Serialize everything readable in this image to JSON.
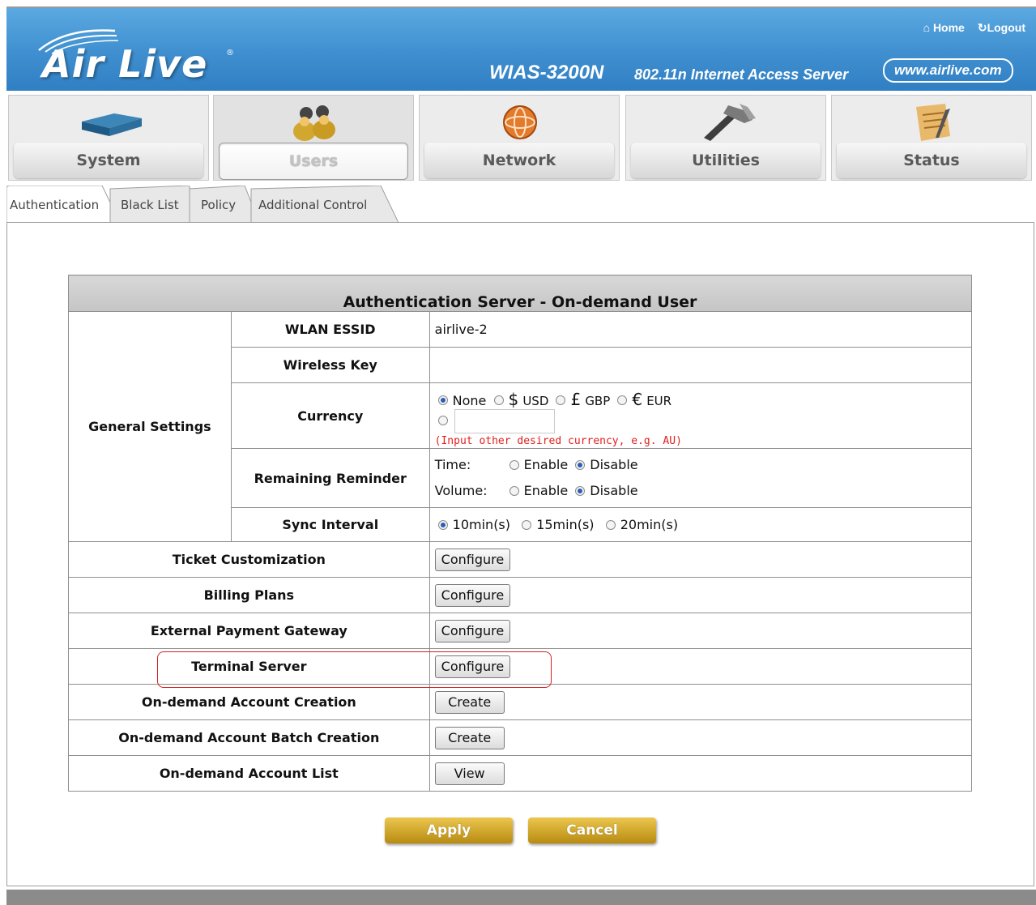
{
  "header": {
    "brand": "Air Live",
    "product": "WIAS-3200N",
    "product_desc": "802.11n Internet Access Server",
    "site": "www.airlive.com",
    "home_label": "Home",
    "logout_label": "Logout"
  },
  "nav": [
    {
      "label": "System",
      "icon": "router-icon"
    },
    {
      "label": "Users",
      "icon": "users-icon",
      "active": true
    },
    {
      "label": "Network",
      "icon": "globe-icon"
    },
    {
      "label": "Utilities",
      "icon": "hammer-icon"
    },
    {
      "label": "Status",
      "icon": "notepad-icon"
    }
  ],
  "subtabs": [
    "Authentication",
    "Black List",
    "Policy",
    "Additional Control"
  ],
  "table": {
    "title": "Authentication Server - On-demand User",
    "general_settings_label": "General Settings",
    "wlan_essid": {
      "label": "WLAN ESSID",
      "value": "airlive-2"
    },
    "wireless_key": {
      "label": "Wireless Key",
      "value": ""
    },
    "currency": {
      "label": "Currency",
      "options": [
        {
          "symbol": "",
          "code": "None",
          "selected": true
        },
        {
          "symbol": "$",
          "code": "USD",
          "selected": false
        },
        {
          "symbol": "£",
          "code": "GBP",
          "selected": false
        },
        {
          "symbol": "€",
          "code": "EUR",
          "selected": false
        }
      ],
      "other_value": "",
      "hint": "(Input other desired currency, e.g. AU)"
    },
    "reminder": {
      "label": "Remaining Reminder",
      "time_label": "Time:",
      "volume_label": "Volume:",
      "enable": "Enable",
      "disable": "Disable",
      "time_selected": "Disable",
      "volume_selected": "Disable"
    },
    "sync": {
      "label": "Sync Interval",
      "options": [
        "10min(s)",
        "15min(s)",
        "20min(s)"
      ],
      "selected": "10min(s)"
    },
    "rows": [
      {
        "label": "Ticket Customization",
        "button": "Configure"
      },
      {
        "label": "Billing Plans",
        "button": "Configure"
      },
      {
        "label": "External Payment Gateway",
        "button": "Configure"
      },
      {
        "label": "Terminal Server",
        "button": "Configure"
      },
      {
        "label": "On-demand Account Creation",
        "button": "Create"
      },
      {
        "label": "On-demand Account Batch Creation",
        "button": "Create"
      },
      {
        "label": "On-demand Account List",
        "button": "View"
      }
    ]
  },
  "buttons": {
    "apply": "Apply",
    "cancel": "Cancel"
  },
  "colors": {
    "header_blue": "#3f8fd0",
    "highlight_red": "#d5211f",
    "gold_button": "#c99c1f",
    "hint_red": "#e0201e"
  }
}
